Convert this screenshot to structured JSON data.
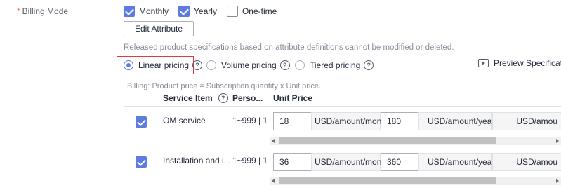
{
  "form": {
    "required_mark": "*",
    "billing_mode_label": "Billing Mode"
  },
  "billing_modes": [
    {
      "label": "Monthly",
      "checked": true
    },
    {
      "label": "Yearly",
      "checked": true
    },
    {
      "label": "One-time",
      "checked": false
    }
  ],
  "edit_attribute_label": "Edit Attribute",
  "hint": "Released product specifications based on attribute definitions cannot be modified or deleted.",
  "pricing_options": [
    {
      "label": "Linear pricing",
      "selected": true
    },
    {
      "label": "Volume pricing",
      "selected": false
    },
    {
      "label": "Tiered pricing",
      "selected": false
    }
  ],
  "help_glyph": "?",
  "preview_label": "Preview Specifications",
  "table": {
    "billing_note": "Billing: Product price = Subscription quantity x Unit price.",
    "headers": {
      "service_item": "Service Item",
      "person": "Perso...",
      "unit_price": "Unit Price"
    },
    "rows": [
      {
        "checked": true,
        "service_item": "OM service",
        "range": "1~999 | 1",
        "monthly_price": "18",
        "monthly_unit": "USD/amount/month",
        "yearly_price": "180",
        "yearly_unit": "USD/amount/year",
        "extra_unit": "USD/amou"
      },
      {
        "checked": true,
        "service_item": "Installation and i...",
        "range": "1~999 | 1",
        "monthly_price": "36",
        "monthly_unit": "USD/amount/month",
        "yearly_price": "360",
        "yearly_unit": "USD/amount/year",
        "extra_unit": "USD/amou"
      }
    ]
  },
  "colors": {
    "accent": "#5e7ce0",
    "highlight": "#e53935",
    "required": "#fa6a5c"
  }
}
